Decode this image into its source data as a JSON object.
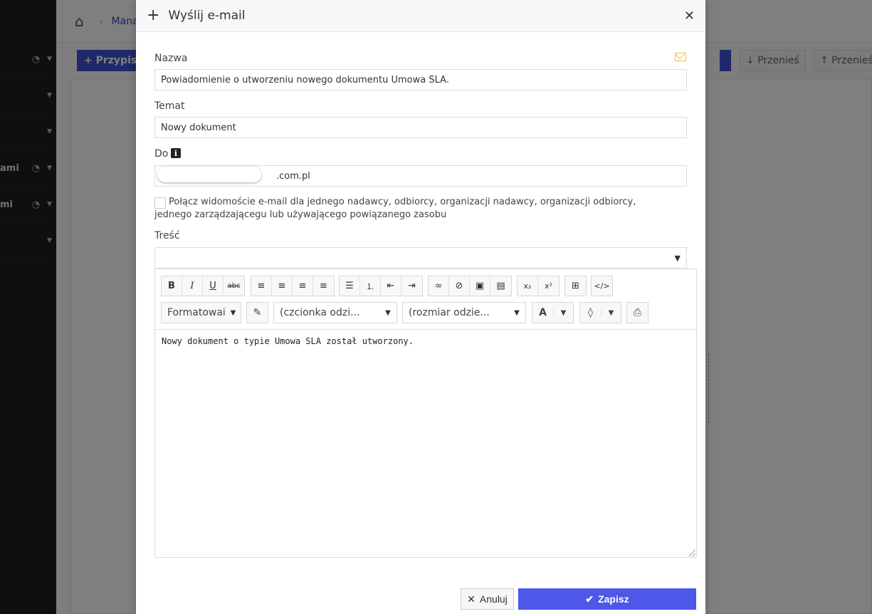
{
  "background": {
    "breadcrumb": "Mana",
    "primary_button": "Przypisz",
    "move_down_label": "Przenieś",
    "move_up_label": "Przenieś",
    "sidebar_items": [
      {
        "label": "",
        "has_gauge": true
      },
      {
        "label": "",
        "has_gauge": false
      },
      {
        "label": "",
        "has_gauge": false
      },
      {
        "label": "ami",
        "has_gauge": true
      },
      {
        "label": "mi",
        "has_gauge": true
      },
      {
        "label": "",
        "has_gauge": false
      }
    ]
  },
  "modal": {
    "title": "Wyślij e-mail",
    "name_label": "Nazwa",
    "name_value": "Powiadomienie o utworzeniu nowego dokumentu Umowa SLA.",
    "subject_label": "Temat",
    "subject_value": "Nowy dokument",
    "to_label": "Do",
    "to_value_visible": ".com.pl",
    "merge_checkbox_label": "Połącz widomoście e-mail dla jednego nadawcy, odbiorcy, organizacji nadawcy, organizacji odbiorcy, jednego zarządzającegu lub używającego powiązanego zasobu",
    "merge_checked": false,
    "body_label": "Treść",
    "editor": {
      "format_label": "Formatowai",
      "font_label": "(czcionka odzi...",
      "size_label": "(rozmiar odzie...",
      "content": "Nowy dokument o typie Umowa SLA został utworzony."
    },
    "cancel_label": "Anuluj",
    "save_label": "Zapisz"
  },
  "colors": {
    "accent": "#4d57e8",
    "mail_icon": "#f2c12e",
    "sidebar_bg": "#1f1f1f"
  }
}
